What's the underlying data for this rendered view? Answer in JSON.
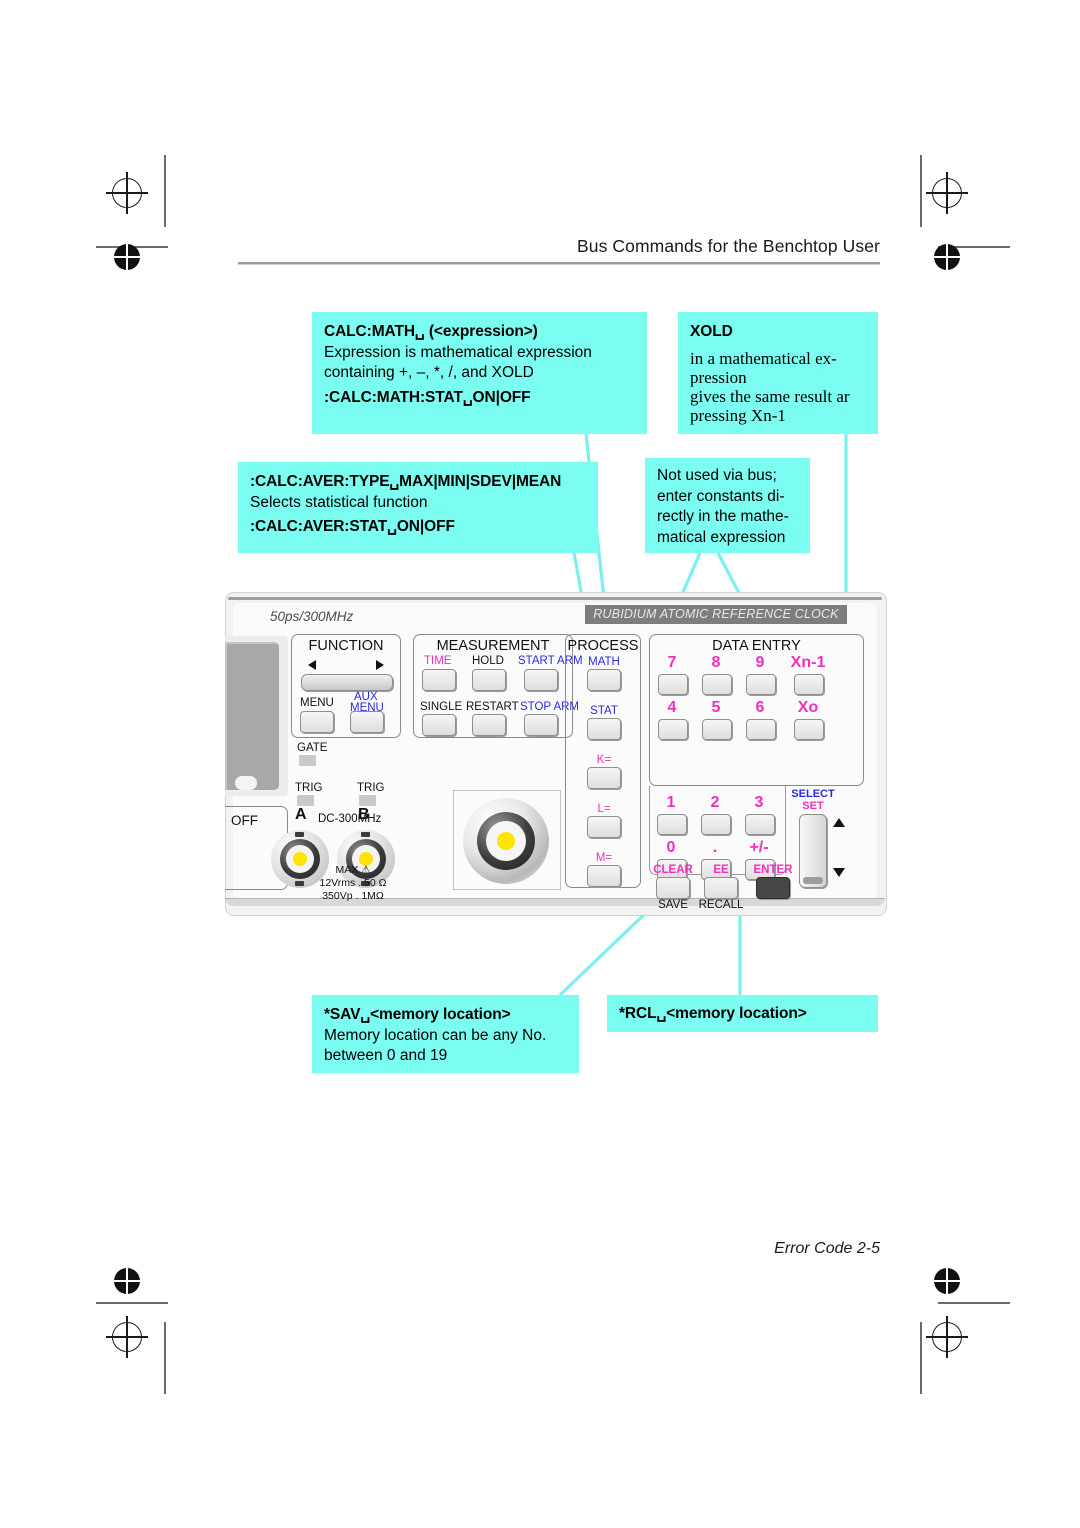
{
  "header": {
    "title": "Bus Commands for the Benchtop User"
  },
  "footer": {
    "text": "Error Code 2-5"
  },
  "callouts": {
    "calc_math": {
      "title": "CALC:MATH␣ (<expression>)",
      "body_line1": "Expression is mathematical expression",
      "body_line2": "containing +, –, *, /,  and XOLD",
      "title2": ":CALC:MATH:STAT␣ON|OFF"
    },
    "xold": {
      "title": "XOLD",
      "body": "in a mathematical ex-pression gives the same result ar pressing Xn-1",
      "body_line1": "in a mathematical ex-",
      "body_line2": "pression",
      "body_line3": "gives the same result ar",
      "body_line4": "pressing Xn-1"
    },
    "calc_aver": {
      "title": ":CALC:AVER:TYPE␣MAX|MIN|SDEV|MEAN",
      "body_line1": "Selects statistical function",
      "title2": ":CALC:AVER:STAT␣ON|OFF"
    },
    "not_used": {
      "line1": "Not used via bus;",
      "line2": "enter constants di-",
      "line3": "rectly in the mathe-",
      "line4": "matical expression"
    },
    "sav": {
      "title": "*SAV␣<memory location>",
      "body_line1": "Memory location can be any No.",
      "body_line2": "between 0 and 19"
    },
    "rcl": {
      "title": "*RCL␣<memory location>"
    }
  },
  "panel": {
    "model_text": "50ps/300MHz",
    "banner_text": "RUBIDIUM ATOMIC REFERENCE CLOCK",
    "off_label": "OFF",
    "groups": {
      "function": {
        "title": "FUNCTION",
        "menu_label": "MENU",
        "aux_label_line1": "AUX",
        "aux_label_line2": "MENU"
      },
      "measurement": {
        "title": "MEASUREMENT",
        "buttons": [
          {
            "label": "TIME",
            "color": "magenta"
          },
          {
            "label": "HOLD",
            "color": "black"
          },
          {
            "label": "START ARM",
            "color": "blue"
          },
          {
            "label": "SINGLE",
            "color": "black"
          },
          {
            "label": "RESTART",
            "color": "black"
          },
          {
            "label": "STOP ARM",
            "color": "blue"
          }
        ]
      },
      "process": {
        "title": "PROCESS",
        "buttons": [
          {
            "label": "MATH",
            "color": "blue"
          },
          {
            "label": "STAT",
            "color": "blue"
          },
          {
            "label": "K=",
            "color": "magenta"
          },
          {
            "label": "L=",
            "color": "magenta"
          },
          {
            "label": "M=",
            "color": "magenta"
          }
        ]
      },
      "data_entry": {
        "title": "DATA ENTRY",
        "keys": [
          "7",
          "8",
          "9",
          "Xn-1",
          "4",
          "5",
          "6",
          "Xo",
          "1",
          "2",
          "3",
          "0",
          ".",
          "+/-"
        ],
        "select_label": "SELECT",
        "set_label": "SET",
        "clear_label": "CLEAR",
        "ee_label": "EE",
        "enter_label": "ENTER",
        "save_label": "SAVE",
        "recall_label": "RECALL"
      }
    },
    "indicators": {
      "gate_label": "GATE",
      "trig_a_label": "TRIG",
      "trig_b_label": "TRIG"
    },
    "connectors": {
      "chan_a": "A",
      "chan_b": "B",
      "bandwidth": "DC-300MHz",
      "max_line1": "MAX ⚠",
      "max_line2": "12Vrms . 50 Ω",
      "max_line3": "350Vp . 1MΩ"
    }
  },
  "colors": {
    "callout_fill": "#7bfdf2",
    "leader_line": "#7bf0ef",
    "magenta": "#ef2fbe",
    "blue": "#2a2ae0",
    "banner_bg": "#7d7d7d"
  }
}
